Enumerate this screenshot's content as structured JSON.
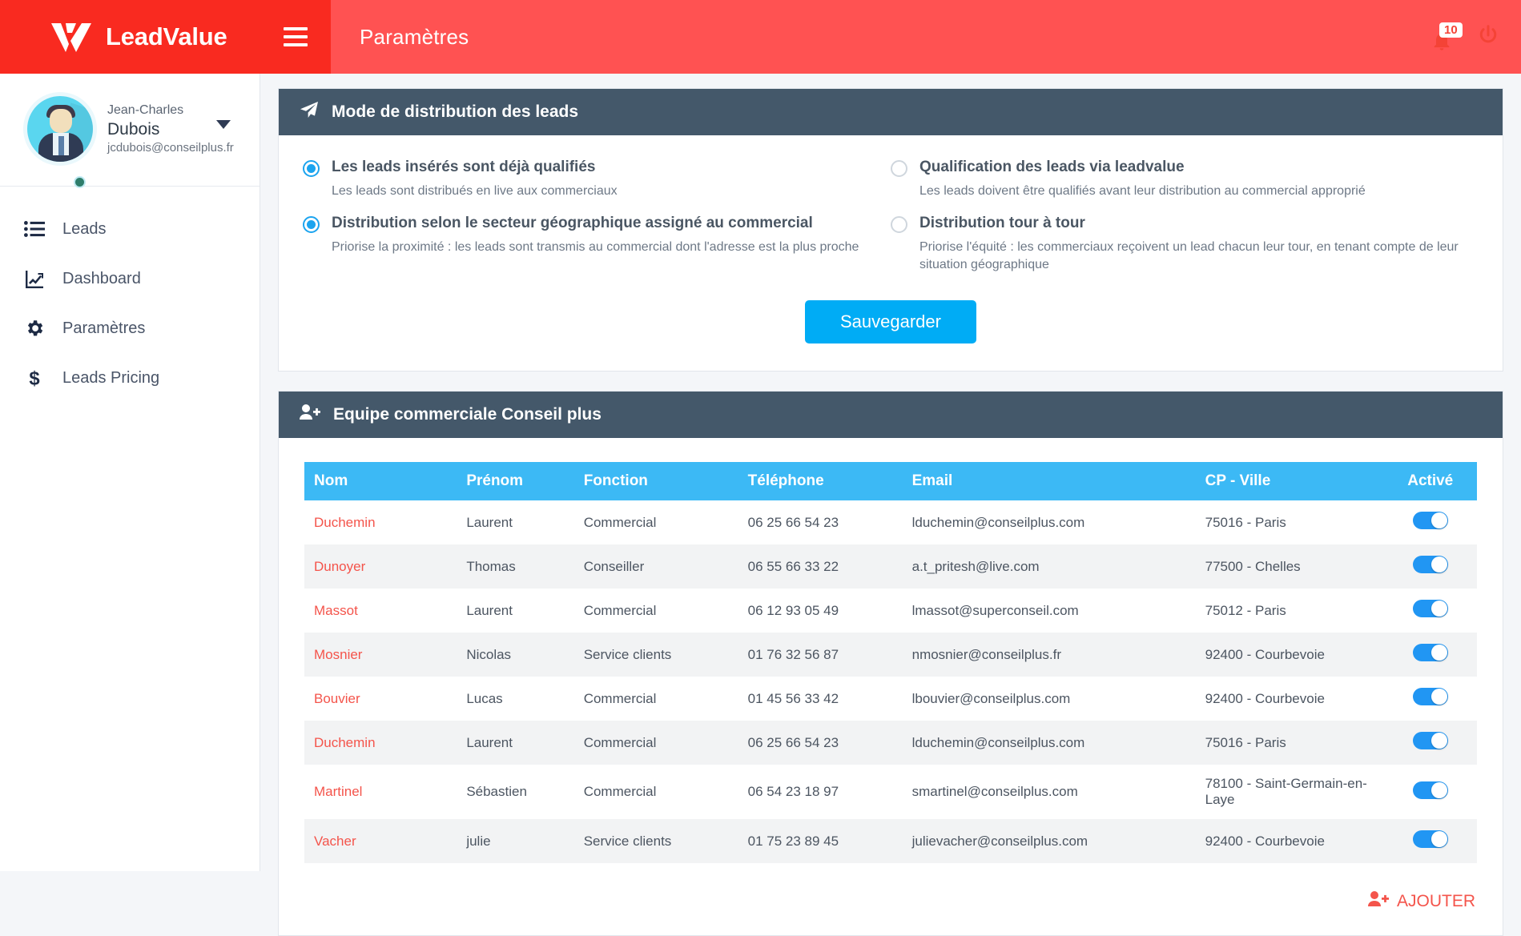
{
  "brand": {
    "name": "LeadValue",
    "logo_icon": "leadvalue-v-logo"
  },
  "header": {
    "menu_icon": "hamburger-icon",
    "title": "Paramètres",
    "notification_icon": "bell-icon",
    "notification_count": "10",
    "logout_icon": "power-icon"
  },
  "sidebar": {
    "profile": {
      "first_name": "Jean-Charles",
      "last_name": "Dubois",
      "email": "jcdubois@conseilplus.fr",
      "avatar_icon": "user-avatar",
      "caret_icon": "caret-down-icon",
      "status_icon": "online-dot"
    },
    "items": [
      {
        "label": "Leads",
        "icon": "list-icon"
      },
      {
        "label": "Dashboard",
        "icon": "chart-line-icon"
      },
      {
        "label": "Paramètres",
        "icon": "gear-icon"
      },
      {
        "label": "Leads Pricing",
        "icon": "dollar-icon"
      }
    ]
  },
  "distribution_card": {
    "icon": "paper-plane-icon",
    "title": "Mode de distribution des leads",
    "options": [
      {
        "title": "Les leads insérés sont déjà qualifiés",
        "subtitle": "Les leads sont distribués en live aux commerciaux",
        "selected": true
      },
      {
        "title": "Qualification des leads via leadvalue",
        "subtitle": "Les leads doivent être qualifiés avant leur distribution au commercial approprié",
        "selected": false
      },
      {
        "title": "Distribution selon le secteur géographique assigné au commercial",
        "subtitle": "Priorise la proximité : les leads sont transmis au commercial dont l'adresse est la plus proche",
        "selected": true
      },
      {
        "title": "Distribution tour à tour",
        "subtitle": "Priorise l'équité : les commerciaux reçoivent un lead chacun leur tour, en tenant compte de leur situation  géographique",
        "selected": false
      }
    ],
    "save_label": "Sauvegarder"
  },
  "team_card": {
    "icon": "user-plus-icon",
    "title": "Equipe commerciale Conseil plus",
    "columns": [
      "Nom",
      "Prénom",
      "Fonction",
      "Téléphone",
      "Email",
      "CP - Ville",
      "Activé"
    ],
    "rows": [
      {
        "nom": "Duchemin",
        "prenom": "Laurent",
        "fonction": "Commercial",
        "telephone": "06 25 66 54 23",
        "email": "lduchemin@conseilplus.com",
        "ville": "75016 - Paris",
        "active": true
      },
      {
        "nom": "Dunoyer",
        "prenom": "Thomas",
        "fonction": "Conseiller",
        "telephone": "06 55 66 33 22",
        "email": "a.t_pritesh@live.com",
        "ville": "77500 - Chelles",
        "active": true
      },
      {
        "nom": "Massot",
        "prenom": "Laurent",
        "fonction": "Commercial",
        "telephone": "06 12 93 05 49",
        "email": "lmassot@superconseil.com",
        "ville": "75012 - Paris",
        "active": true
      },
      {
        "nom": "Mosnier",
        "prenom": "Nicolas",
        "fonction": "Service clients",
        "telephone": "01 76 32 56 87",
        "email": "nmosnier@conseilplus.fr",
        "ville": "92400 - Courbevoie",
        "active": true
      },
      {
        "nom": "Bouvier",
        "prenom": "Lucas",
        "fonction": "Commercial",
        "telephone": "01 45 56 33 42",
        "email": "lbouvier@conseilplus.com",
        "ville": "92400 - Courbevoie",
        "active": true
      },
      {
        "nom": "Duchemin",
        "prenom": "Laurent",
        "fonction": "Commercial",
        "telephone": "06 25 66 54 23",
        "email": "lduchemin@conseilplus.com",
        "ville": "75016 - Paris",
        "active": true
      },
      {
        "nom": "Martinel",
        "prenom": "Sébastien",
        "fonction": "Commercial",
        "telephone": "06 54 23 18 97",
        "email": "smartinel@conseilplus.com",
        "ville": "78100 - Saint-Germain-en-Laye",
        "active": true
      },
      {
        "nom": "Vacher",
        "prenom": "julie",
        "fonction": "Service clients",
        "telephone": "01 75 23 89 45",
        "email": "julievacher@conseilplus.com",
        "ville": "92400 - Courbevoie",
        "active": true
      }
    ],
    "add_label": "AJOUTER",
    "add_icon": "user-plus-icon"
  },
  "colors": {
    "brand_red": "#f92a20",
    "header_red": "#ff5252",
    "panel_slate": "#44586a",
    "accent_blue": "#00acf5",
    "table_header_blue": "#3cb9f5",
    "link_red": "#f4544b",
    "toggle_on": "#2196f3"
  }
}
